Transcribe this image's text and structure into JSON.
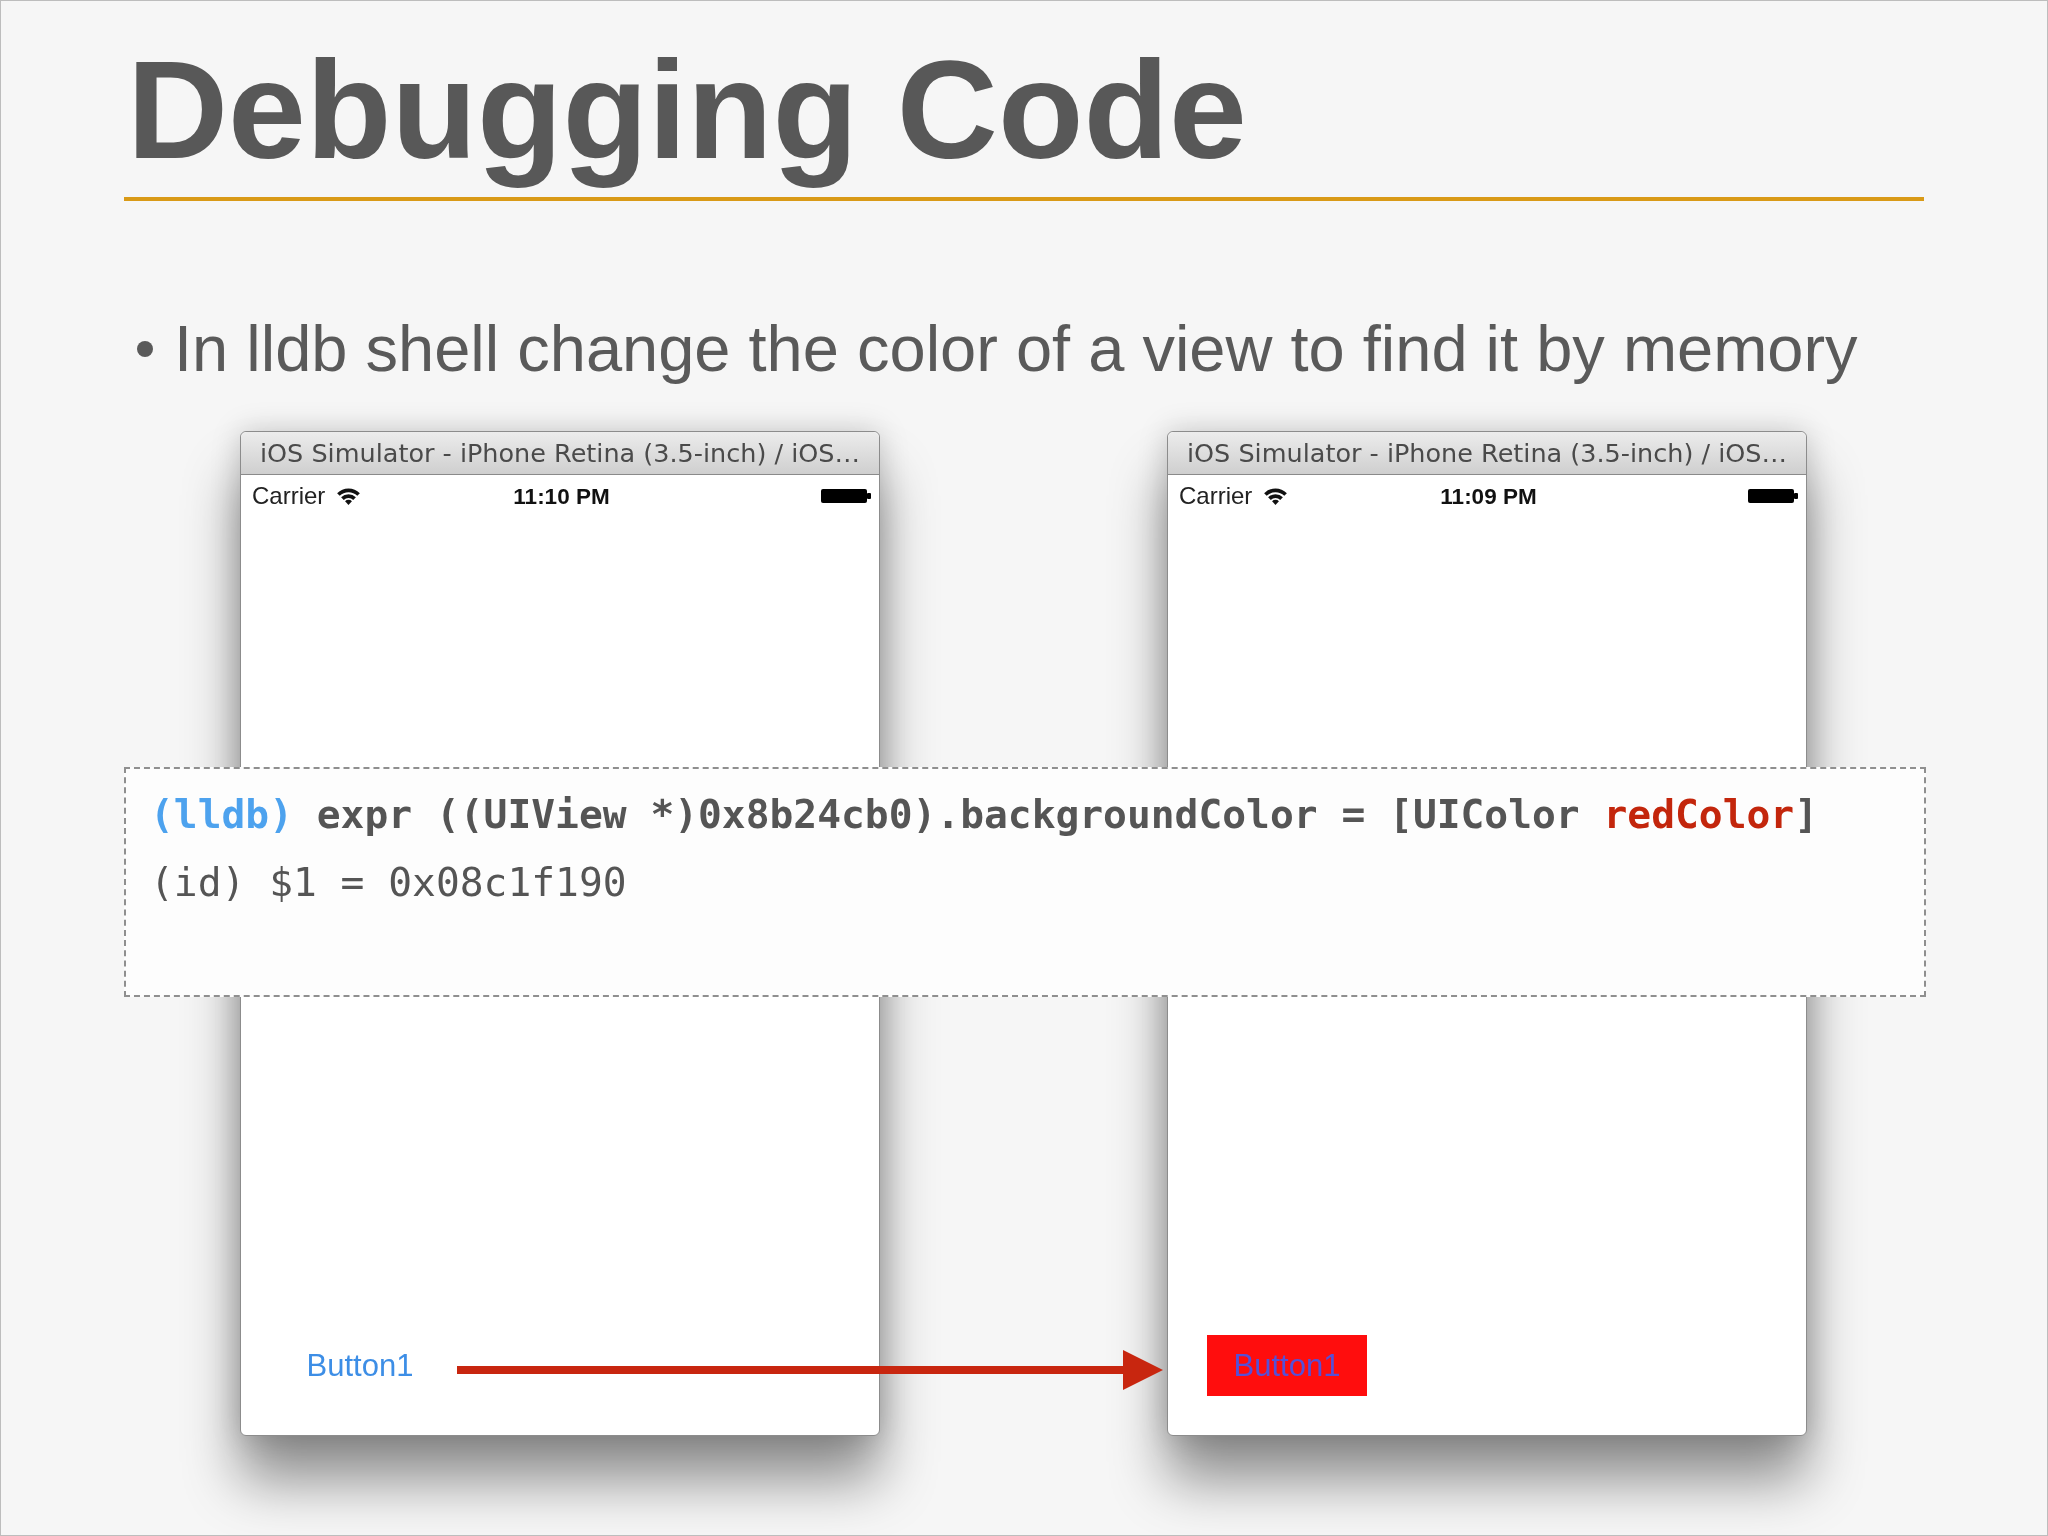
{
  "slide": {
    "title": "Debugging Code",
    "bullets": [
      "In lldb shell change the color of a view to find it by memory"
    ]
  },
  "simulators": [
    {
      "window_title": "iOS Simulator - iPhone Retina (3.5-inch) / iOS…",
      "carrier": "Carrier",
      "time": "11:10 PM",
      "button": {
        "label": "Button1",
        "highlighted": false
      }
    },
    {
      "window_title": "iOS Simulator - iPhone Retina (3.5-inch) / iOS…",
      "carrier": "Carrier",
      "time": "11:09 PM",
      "button": {
        "label": "Button1",
        "highlighted": true
      }
    }
  ],
  "console": {
    "lines": [
      {
        "kind": "command",
        "segments": [
          {
            "kind": "prompt",
            "text": "(lldb)"
          },
          {
            "kind": "plain",
            "text": " expr ((UIView *)0x8b24cb0).backgroundColor = [UIColor "
          },
          {
            "kind": "method",
            "text": "redColor"
          },
          {
            "kind": "plain",
            "text": "]"
          }
        ]
      },
      {
        "kind": "output",
        "segments": [
          {
            "kind": "plain",
            "text": "(id) $1 = 0x08c1f190"
          }
        ]
      }
    ]
  }
}
